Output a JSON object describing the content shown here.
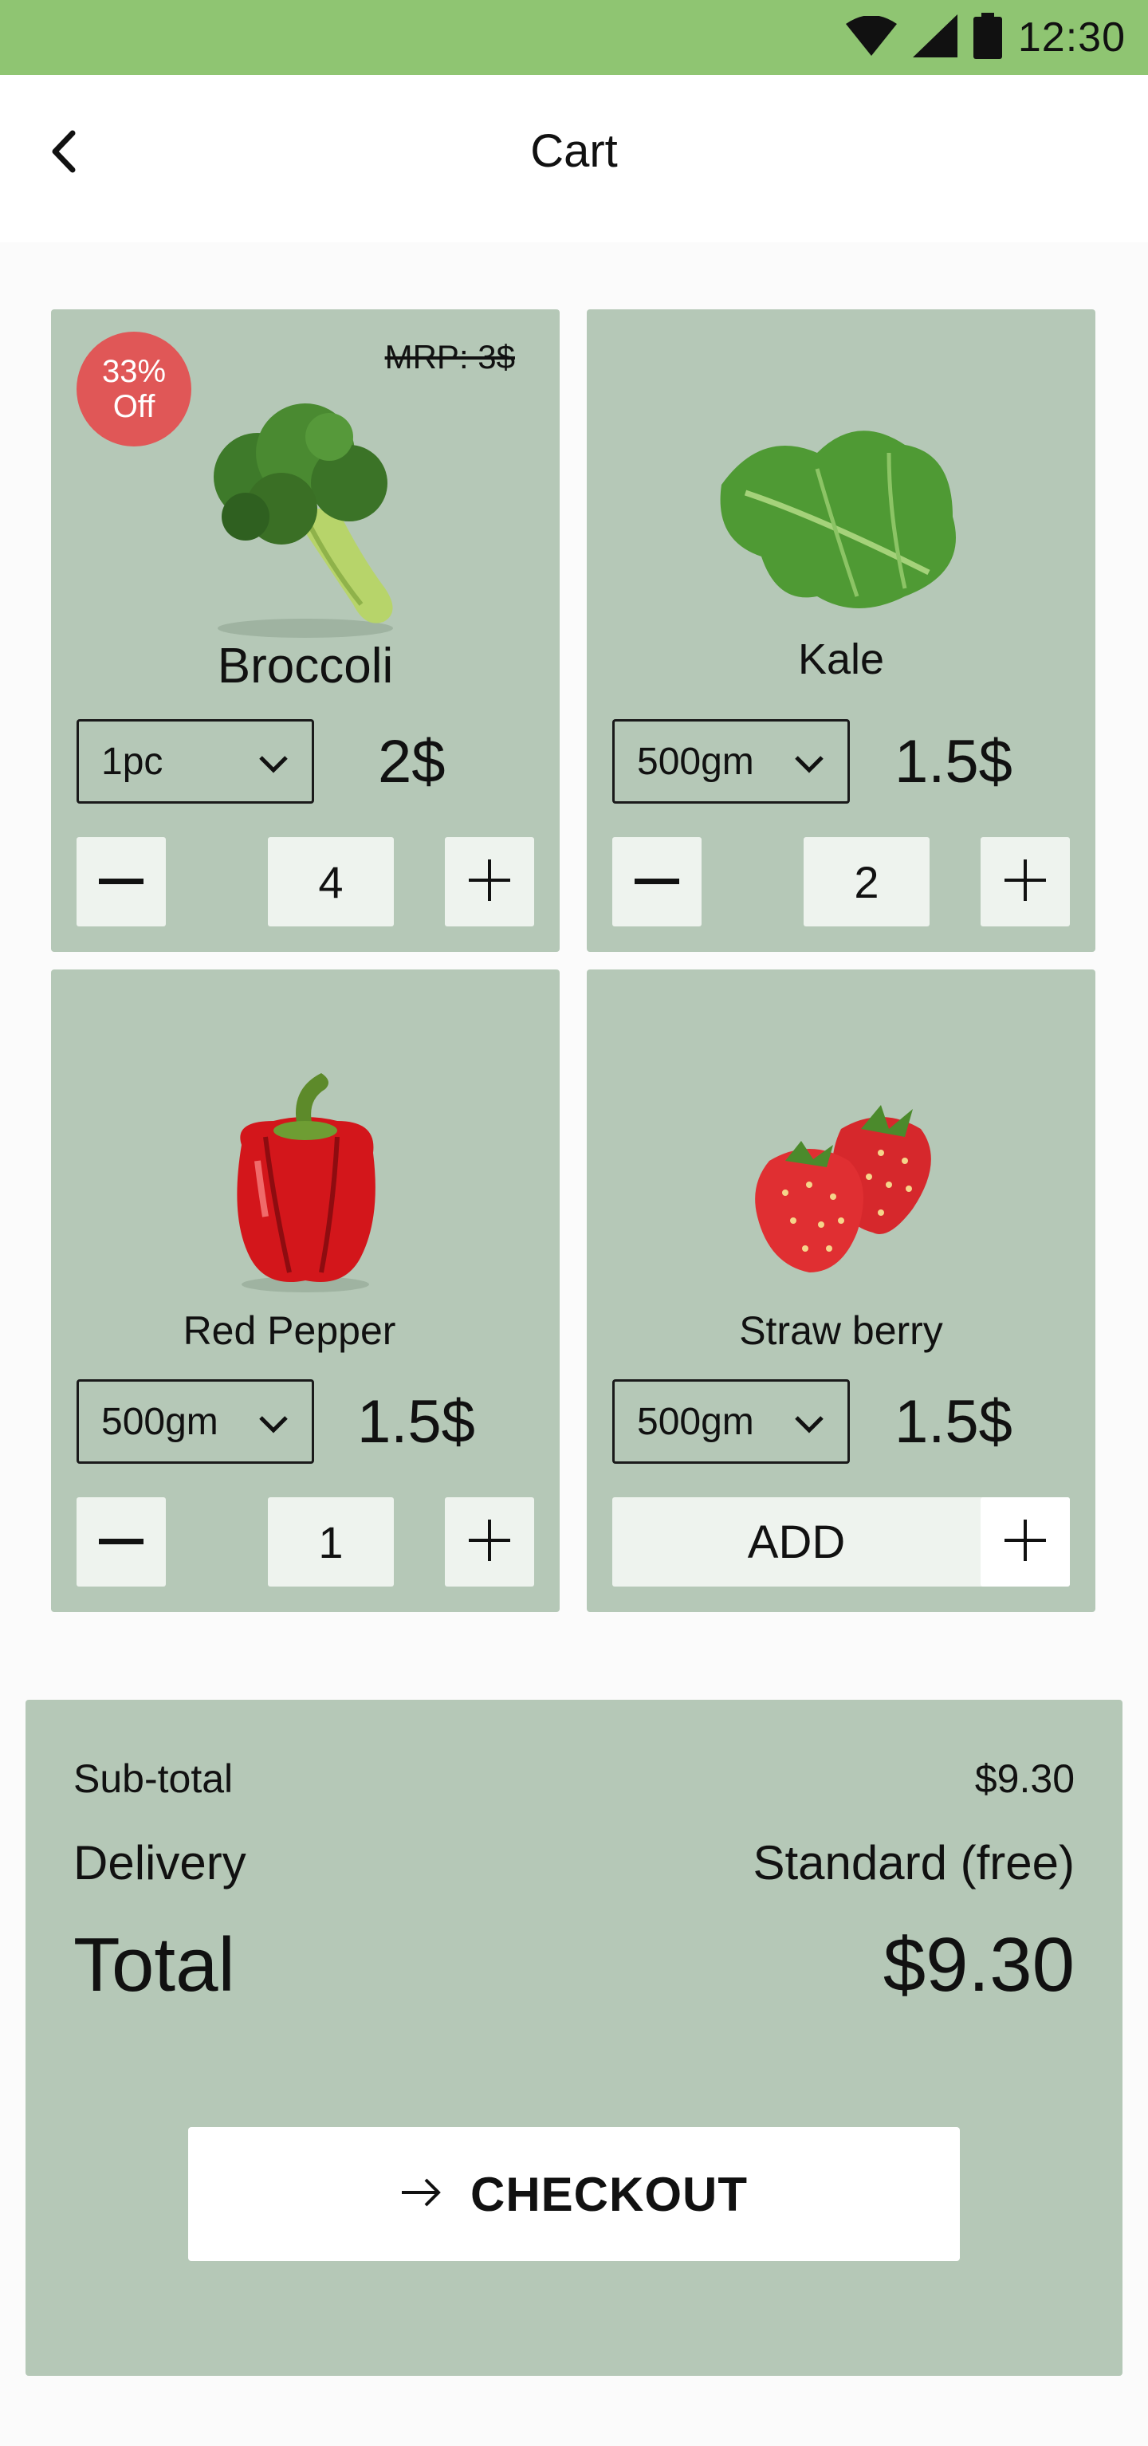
{
  "status_bar": {
    "time": "12:30",
    "icons": [
      "wifi-icon",
      "signal-icon",
      "battery-icon"
    ],
    "color": "#8fc572"
  },
  "header": {
    "title": "Cart",
    "back_icon": "chevron-left-icon"
  },
  "colors": {
    "card_bg": "#b5c8b7",
    "badge": "#e05757",
    "control_bg": "#eef3ee"
  },
  "products": [
    {
      "name": "Broccoli",
      "badge": {
        "percent": "33%",
        "text": "Off"
      },
      "mrp": "MRP: 3$",
      "unit": "1pc",
      "price": "2$",
      "quantity": "4"
    },
    {
      "name": "Kale",
      "unit": "500gm",
      "price": "1.5$",
      "quantity": "2"
    },
    {
      "name": "Red Pepper",
      "unit": "500gm",
      "price": "1.5$",
      "quantity": "1"
    },
    {
      "name": "Straw berry",
      "unit": "500gm",
      "price": "1.5$",
      "add_label": "ADD"
    }
  ],
  "summary": {
    "subtotal_label": "Sub-total",
    "subtotal_value": "$9.30",
    "delivery_label": "Delivery",
    "delivery_value": "Standard (free)",
    "total_label": "Total",
    "total_value": "$9.30"
  },
  "checkout": {
    "label": "CHECKOUT",
    "icon": "arrow-right-icon"
  }
}
